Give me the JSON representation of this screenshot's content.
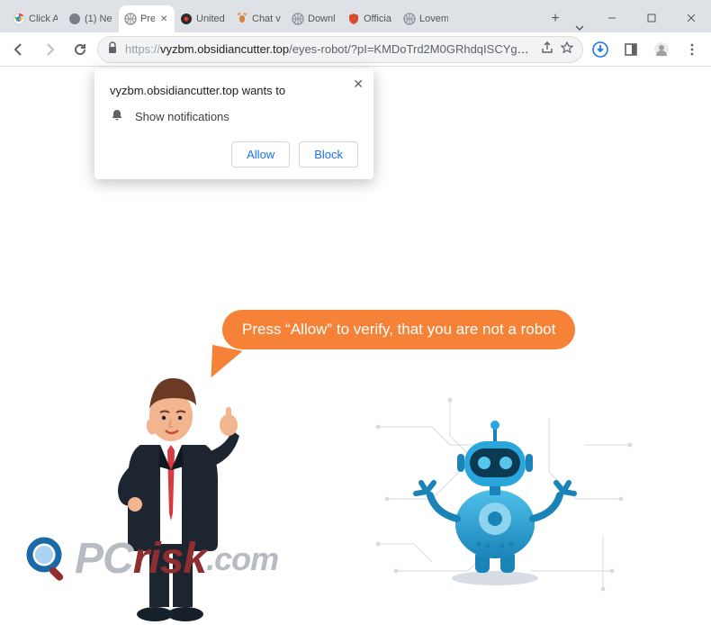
{
  "window": {
    "chevron_visible": true
  },
  "tabs": [
    {
      "label": "Click A",
      "icon": "chrome"
    },
    {
      "label": "(1) Ne",
      "icon": "gray-badge"
    },
    {
      "label": "Pre",
      "icon": "globe",
      "active": true
    },
    {
      "label": "United",
      "icon": "red-dot"
    },
    {
      "label": "Chat v",
      "icon": "deer"
    },
    {
      "label": "Downl",
      "icon": "globe"
    },
    {
      "label": "Officia",
      "icon": "shield"
    },
    {
      "label": "Lovem",
      "icon": "globe"
    }
  ],
  "addressbar": {
    "scheme": "https://",
    "host": "vyzbm.obsidiancutter.top",
    "path": "/eyes-robot/?pI=KMDoTrd2M0GRhdqISCYgAg&sm=..."
  },
  "permission": {
    "title": "vyzbm.obsidiancutter.top wants to",
    "item": "Show notifications",
    "allow": "Allow",
    "block": "Block"
  },
  "bubble": {
    "text": "Press “Allow” to verify, that you are not a robot"
  },
  "watermark": {
    "pc": "PC",
    "risk": "risk",
    "com": ".com"
  }
}
